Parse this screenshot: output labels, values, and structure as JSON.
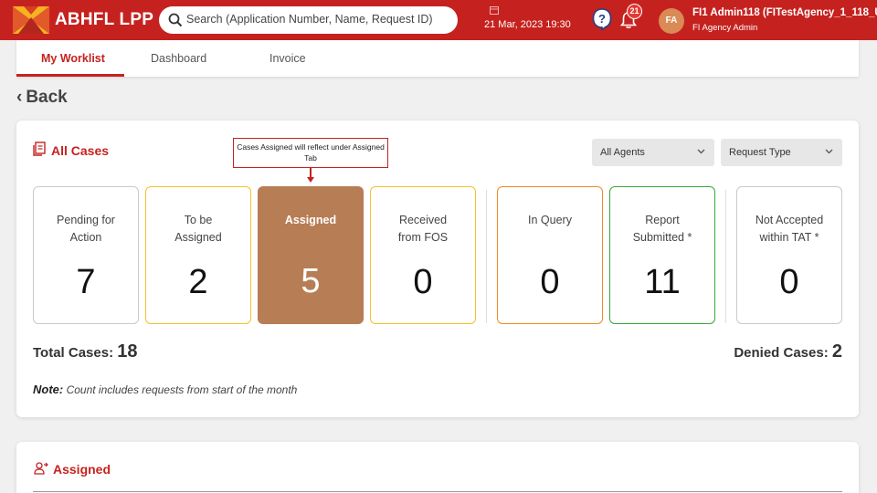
{
  "header": {
    "app_title": "ABHFL LPP",
    "search_placeholder": "Search (Application Number, Name, Request ID)",
    "datetime": "21 Mar, 2023 19:30",
    "notification_count": "21",
    "avatar_initials": "FA",
    "user_name": "FI1 Admin118 (FITestAgency_1_118_User",
    "user_role": "FI Agency Admin",
    "colors": {
      "header_bg": "#c5221f",
      "accent": "#c5221f"
    },
    "icons": [
      "logo-icon",
      "search-icon",
      "calendar-icon",
      "help-icon",
      "bell-icon"
    ]
  },
  "tabs": [
    {
      "label": "My Worklist",
      "active": true
    },
    {
      "label": "Dashboard",
      "active": false
    },
    {
      "label": "Invoice",
      "active": false
    }
  ],
  "back_label": "Back",
  "all_cases": {
    "title": "All Cases",
    "filters": {
      "agents": "All Agents",
      "request_type": "Request Type"
    },
    "callout": "Cases Assigned will reflect under Assigned Tab",
    "stats": [
      {
        "label": "Pending for Action",
        "value": "7",
        "style": "default"
      },
      {
        "label": "To be Assigned",
        "value": "2",
        "style": "yellow"
      },
      {
        "label": "Assigned",
        "value": "5",
        "style": "active"
      },
      {
        "label": "Received from FOS",
        "value": "0",
        "style": "yellow"
      },
      {
        "label": "In Query",
        "value": "0",
        "style": "orange"
      },
      {
        "label": "Report Submitted *",
        "value": "11",
        "style": "green"
      },
      {
        "label": "Not Accepted within TAT *",
        "value": "0",
        "style": "default"
      }
    ],
    "total_label": "Total Cases:",
    "total_value": "18",
    "denied_label": "Denied Cases:",
    "denied_value": "2",
    "note_label": "Note:",
    "note_text": "Count includes requests from start of the month"
  },
  "assigned_section": {
    "title": "Assigned"
  }
}
